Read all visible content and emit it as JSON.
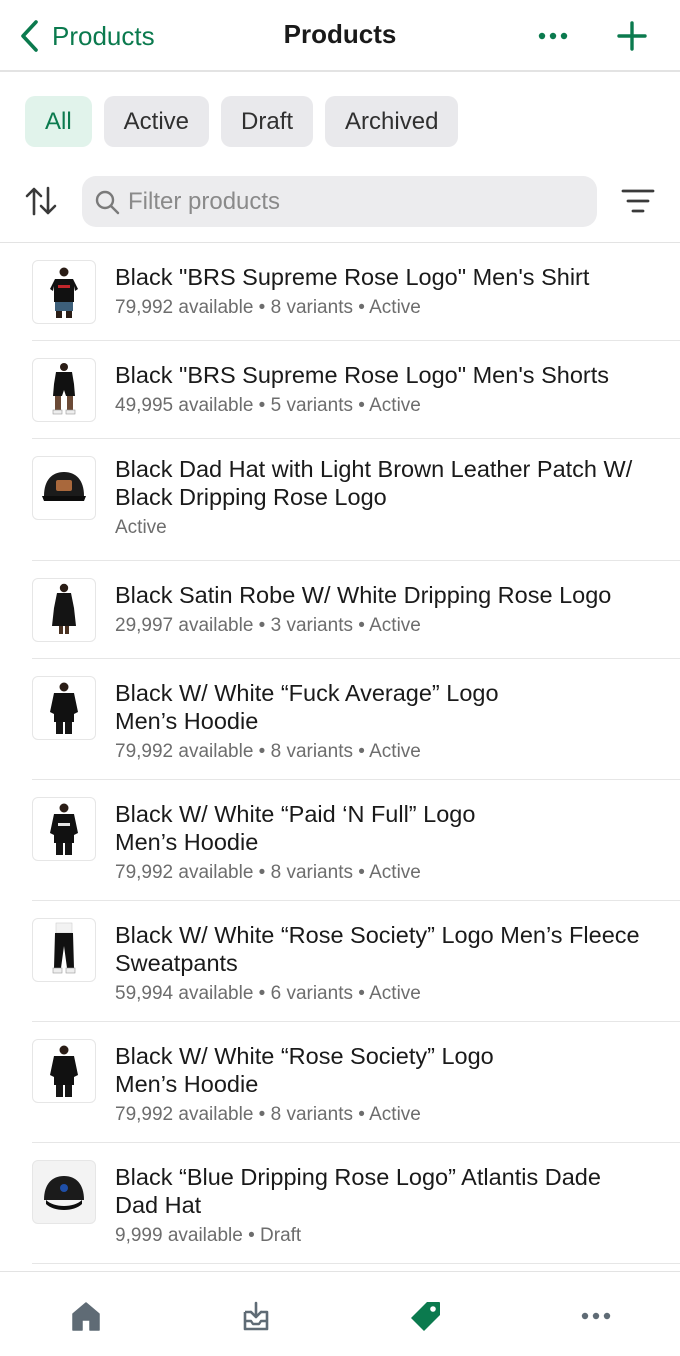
{
  "header": {
    "back_label": "Products",
    "title": "Products",
    "more_icon": "more-horizontal-icon",
    "add_icon": "plus-icon"
  },
  "tabs": [
    {
      "label": "All",
      "active": true
    },
    {
      "label": "Active",
      "active": false
    },
    {
      "label": "Draft",
      "active": false
    },
    {
      "label": "Archived",
      "active": false
    }
  ],
  "search": {
    "placeholder": "Filter products",
    "value": ""
  },
  "products": [
    {
      "name": "Black \"BRS Supreme Rose Logo\" Men's Shirt",
      "meta": "79,992 available • 8 variants • Active",
      "thumb": "shirt"
    },
    {
      "name": "Black \"BRS Supreme Rose Logo\" Men's Shorts",
      "meta": "49,995 available • 5 variants • Active",
      "thumb": "shorts"
    },
    {
      "name": "Black Dad Hat with Light Brown Leather Patch W/ Black Dripping Rose Logo",
      "meta": "Active",
      "thumb": "hat-patch"
    },
    {
      "name": "Black Satin Robe W/ White Dripping Rose Logo",
      "meta": "29,997 available • 3 variants • Active",
      "thumb": "robe"
    },
    {
      "name": "Black W/ White “Fuck Average” Logo\nMen’s Hoodie",
      "meta": "79,992 available • 8 variants • Active",
      "thumb": "hoodie"
    },
    {
      "name": "Black W/ White “Paid ‘N Full” Logo\nMen’s Hoodie",
      "meta": "79,992 available • 8 variants • Active",
      "thumb": "hoodie-front"
    },
    {
      "name": "Black W/ White “Rose Society” Logo Men’s Fleece Sweatpants",
      "meta": "59,994 available • 6 variants • Active",
      "thumb": "sweatpants"
    },
    {
      "name": "Black W/ White “Rose Society” Logo\nMen’s Hoodie",
      "meta": "79,992 available • 8 variants • Active",
      "thumb": "hoodie"
    },
    {
      "name": "Black “Blue Dripping Rose Logo” Atlantis Dade Dad Hat",
      "meta": "9,999 available • Draft",
      "thumb": "hat-blue"
    }
  ],
  "bottom_nav": [
    {
      "icon": "home-icon",
      "active": false
    },
    {
      "icon": "orders-icon",
      "active": false
    },
    {
      "icon": "products-tag-icon",
      "active": true
    },
    {
      "icon": "more-icon",
      "active": false
    }
  ],
  "colors": {
    "accent": "#0b7a4e",
    "tab_active_bg": "#e1f3eb",
    "tab_bg": "#e9e9ec",
    "nav_inactive": "#5f6b75"
  }
}
